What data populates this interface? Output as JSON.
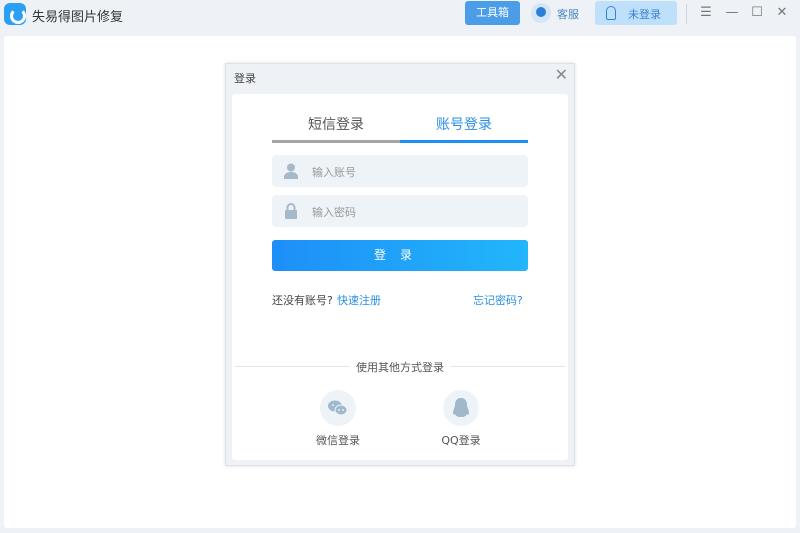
{
  "app": {
    "title": "失易得图片修复",
    "toolbox": "工具箱",
    "service": "客服",
    "login_status": "未登录"
  },
  "window_controls": {
    "menu": "☰",
    "minimize": "—",
    "maximize": "☐",
    "close": "✕"
  },
  "dialog": {
    "title": "登录",
    "close": "✕",
    "tabs": [
      {
        "label": "短信登录",
        "active": false
      },
      {
        "label": "账号登录",
        "active": true
      }
    ],
    "account_placeholder": "输入账号",
    "password_placeholder": "输入密码",
    "submit": "登录",
    "no_account": "还没有账号?",
    "register": "快速注册",
    "forgot": "忘记密码?",
    "other_methods": "使用其他方式登录",
    "wechat": "微信登录",
    "qq": "QQ登录"
  },
  "colors": {
    "accent": "#1d8ff7",
    "link": "#2a8fe6"
  }
}
